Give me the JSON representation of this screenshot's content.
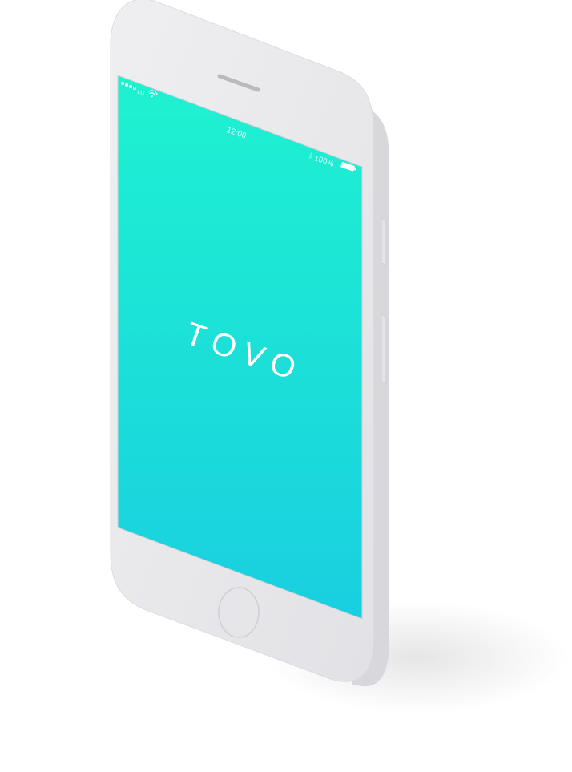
{
  "status_bar": {
    "time": "12:00",
    "battery_percent": "100%",
    "signal_icon": "signal-dots-icon",
    "wifi_icon": "wifi-icon"
  },
  "app": {
    "logo_text": "TOVO"
  },
  "colors": {
    "screen_gradient_top": "#1ef2d0",
    "screen_gradient_bottom": "#19cfe0",
    "device_body": "#e7e7ea",
    "device_edge": "#d6d6da",
    "text": "#ffffff"
  }
}
